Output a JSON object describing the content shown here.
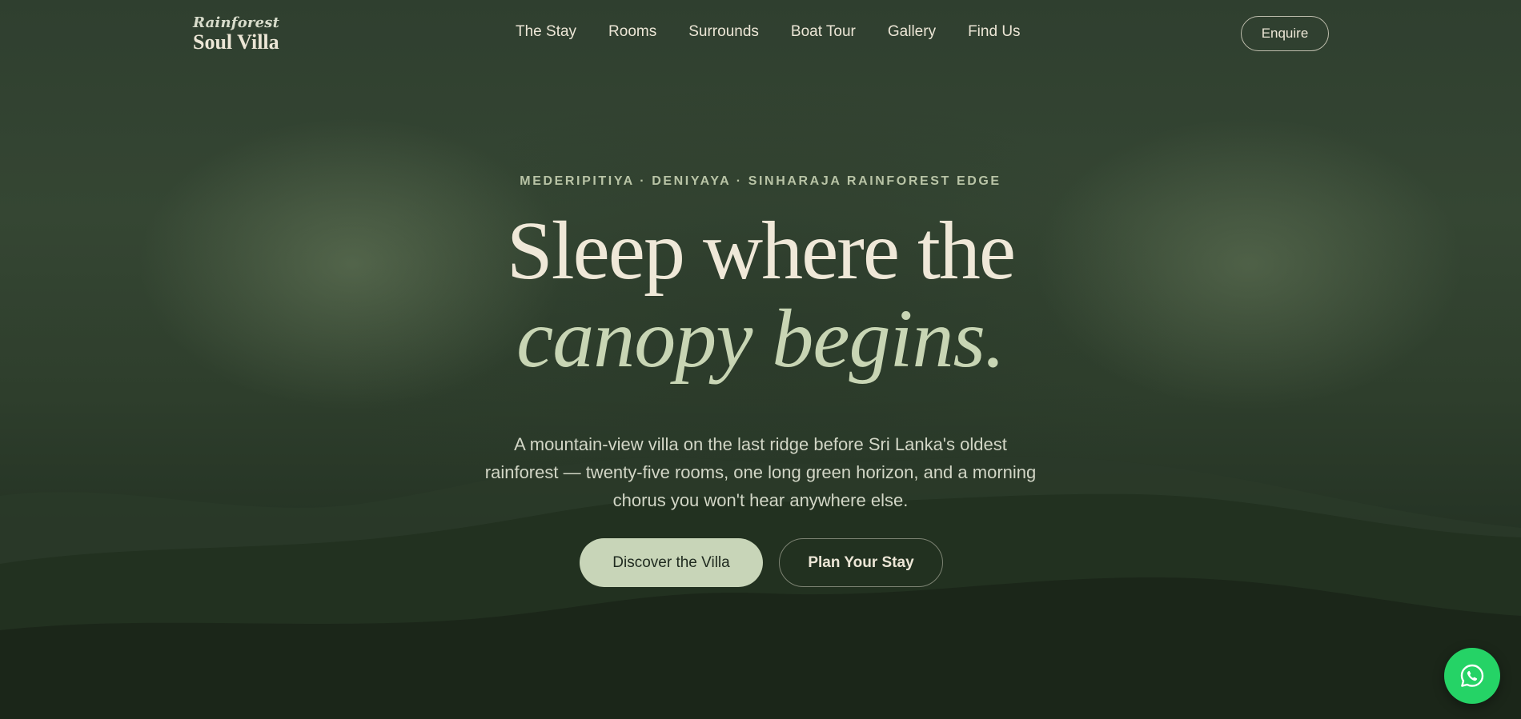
{
  "header": {
    "logo_top": "Rainforest",
    "logo_bottom": "Soul Villa",
    "nav": [
      {
        "label": "The Stay"
      },
      {
        "label": "Rooms"
      },
      {
        "label": "Surrounds"
      },
      {
        "label": "Boat Tour"
      },
      {
        "label": "Gallery"
      },
      {
        "label": "Find Us"
      }
    ],
    "enquire_label": "Enquire"
  },
  "hero": {
    "eyebrow": "MEDERIPITIYA · DENIYAYA · SINHARAJA RAINFOREST EDGE",
    "headline_line1": "Sleep where the",
    "headline_line2": "canopy begins.",
    "intro": "A mountain-view villa on the last ridge before Sri Lanka's oldest rainforest — twenty-five rooms, one long green horizon, and a morning chorus you won't hear anywhere else.",
    "primary_cta": "Discover the Villa",
    "secondary_cta": "Plan Your Stay"
  },
  "floating": {
    "whatsapp_icon": "whatsapp-icon"
  },
  "colors": {
    "background": "#2f3f2f",
    "headline": "#efe8d8",
    "headline_accent": "#c8d5b4",
    "primary_button": "#c8d5b8",
    "whatsapp": "#25d366"
  }
}
